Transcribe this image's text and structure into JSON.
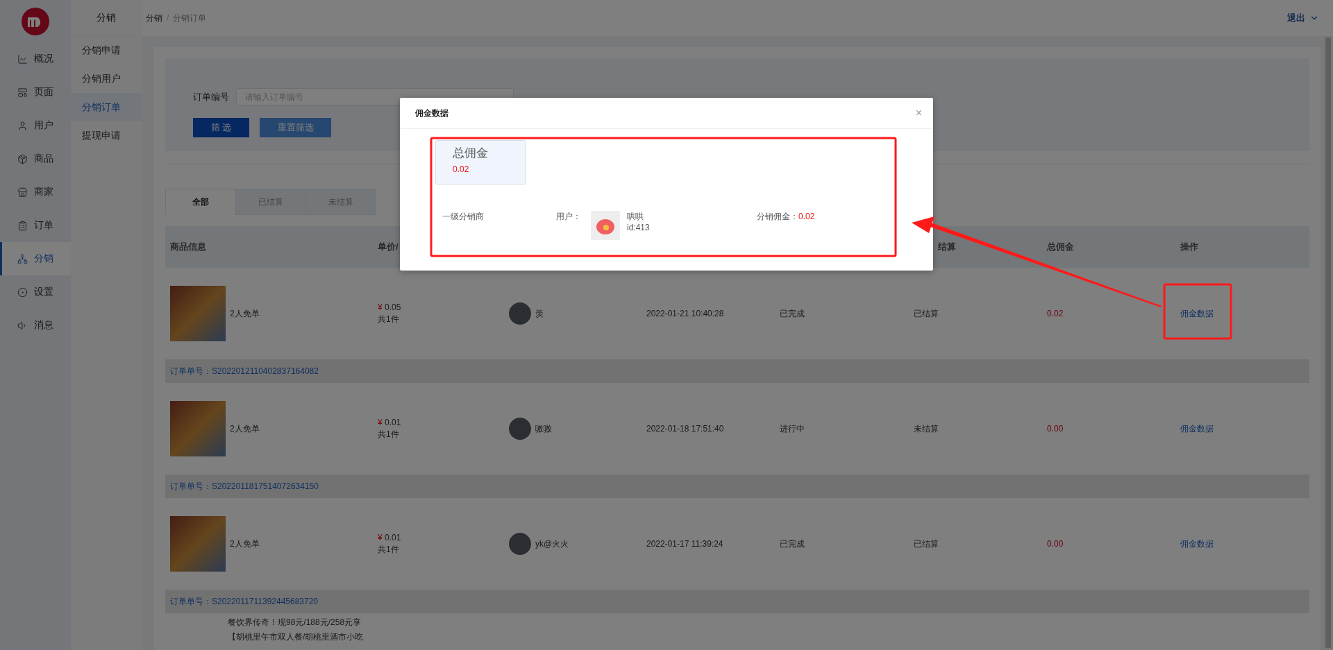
{
  "main_nav": [
    {
      "label": "概况",
      "selected": false
    },
    {
      "label": "页面",
      "selected": false
    },
    {
      "label": "用户",
      "selected": false
    },
    {
      "label": "商品",
      "selected": false
    },
    {
      "label": "商家",
      "selected": false
    },
    {
      "label": "订单",
      "selected": false
    },
    {
      "label": "分销",
      "selected": true
    },
    {
      "label": "设置",
      "selected": false
    },
    {
      "label": "消息",
      "selected": false
    }
  ],
  "sub_nav": {
    "title": "分销",
    "items": [
      {
        "label": "分销申请",
        "selected": false
      },
      {
        "label": "分销用户",
        "selected": false
      },
      {
        "label": "分销订单",
        "selected": true
      },
      {
        "label": "提现申请",
        "selected": false
      }
    ]
  },
  "breadcrumb": {
    "items": [
      "分销",
      "分销订单"
    ],
    "separator": "/"
  },
  "header": {
    "logout": "退出"
  },
  "filter": {
    "label": "订单编号",
    "placeholder": "请输入订单编号",
    "buttons": [
      {
        "label": "筛 选",
        "kind": "primary"
      },
      {
        "label": "重置筛选",
        "kind": "secondary"
      }
    ]
  },
  "tabs": [
    {
      "label": "全部",
      "selected": true
    },
    {
      "label": "已结算",
      "selected": false
    },
    {
      "label": "未结算",
      "selected": false
    }
  ],
  "table": {
    "columns": [
      "商品信息",
      "单价/",
      null,
      null,
      null,
      "结算",
      "总佣金",
      "操作"
    ],
    "rows": [
      {
        "product": "2人免单",
        "currency": "¥",
        "price": "0.05",
        "quantity": "共1件",
        "user": "羡",
        "time": "2022-01-21 10:40:28",
        "status": "已完成",
        "settlement": "已结算",
        "commission": "0.02",
        "action": "佣金数据",
        "order_no": "订单单号：S2022012110402837164082"
      },
      {
        "product": "2人免单",
        "currency": "¥",
        "price": "0.01",
        "quantity": "共1件",
        "user": "嗷嗷",
        "time": "2022-01-18 17:51:40",
        "status": "进行中",
        "settlement": "未结算",
        "commission": "0.00",
        "action": "佣金数据",
        "order_no": "订单单号：S2022011817514072634150"
      },
      {
        "product": "2人免单",
        "currency": "¥",
        "price": "0.01",
        "quantity": "共1件",
        "user": "yk@火火",
        "time": "2022-01-17 11:39:24",
        "status": "已完成",
        "settlement": "已结算",
        "commission": "0.00",
        "action": "佣金数据",
        "order_no": "订单单号：S2022011711392445683720"
      },
      {
        "product_lines": [
          "餐饮界传奇！现98元/188元/258元享",
          "【胡桃里午市双人餐/胡桃里酒市小吃"
        ]
      }
    ]
  },
  "modal": {
    "title": "佣金数据",
    "close": "×",
    "summary": {
      "label": "总佣金",
      "value": "0.02"
    },
    "level_label": "一级分销商",
    "user_label": "用户：",
    "user_name": "哄哄",
    "user_id": "id:413",
    "commission_label": "分销佣金：",
    "commission": "0.02"
  }
}
